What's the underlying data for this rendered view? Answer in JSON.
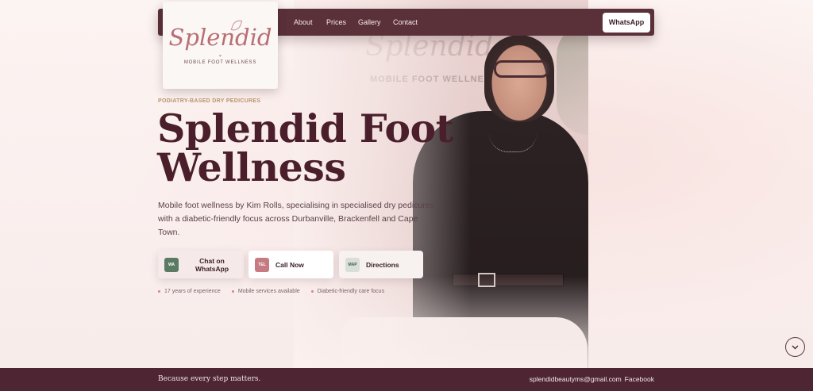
{
  "nav": {
    "links": [
      "About",
      "Prices",
      "Gallery",
      "Contact"
    ],
    "cta_label": "WhatsApp"
  },
  "logo": {
    "script": "Splendid",
    "heart": "♥",
    "subtitle": "MOBILE FOOT WELLNESS"
  },
  "photo": {
    "wall_script": "Splendid",
    "wall_subtitle": "MOBILE FOOT WELLNESS"
  },
  "hero": {
    "eyebrow": "PODIATRY-BASED DRY PEDICURES",
    "title": "Splendid Foot Wellness",
    "description": "Mobile foot wellness by Kim Rolls, specialising in specialised dry pedicures with a diabetic-friendly focus across Durbanville, Brackenfell and Cape Town."
  },
  "actions": [
    {
      "badge": "WA",
      "label": "Chat on WhatsApp"
    },
    {
      "badge": "TEL",
      "label": "Call Now"
    },
    {
      "badge": "MAP",
      "label": "Directions"
    }
  ],
  "features": [
    "17 years of experience",
    "Mobile services available",
    "Diabetic-friendly care focus"
  ],
  "footer": {
    "tagline": "Because every step matters.",
    "email": "splendidbeautyms@gmail.com",
    "facebook": "Facebook"
  },
  "colors": {
    "brand_dark": "#5a3039",
    "footer": "#4e2633",
    "accent_gold": "#b9926a",
    "accent_pink": "#c67b83",
    "whatsapp_green": "#5a7a64"
  },
  "icons": {
    "scroll": "chevron-down-icon"
  }
}
